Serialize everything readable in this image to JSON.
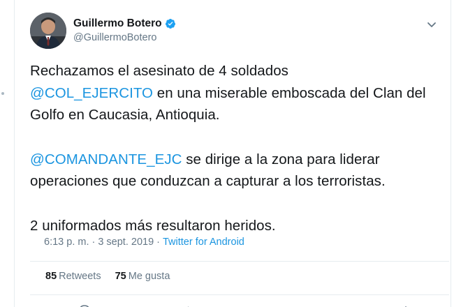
{
  "author": {
    "display_name": "Guillermo Botero",
    "handle": "@GuillermoBotero"
  },
  "tweet": {
    "line1": "Rechazamos el asesinato de 4 soldados",
    "mention1": "@COL_EJERCITO",
    "line2_rest": " en una miserable emboscada del Clan del Golfo en Caucasia, Antioquia.",
    "mention2": "@COMANDANTE_EJC",
    "line3_rest": " se dirige a la zona para liderar operaciones que conduzcan a capturar a los terroristas.",
    "line4": "2 uniformados más resultaron heridos."
  },
  "meta": {
    "time": "6:13 p. m.",
    "sep1": "·",
    "date": "3 sept. 2019",
    "sep2": "·",
    "source": "Twitter for Android"
  },
  "stats": {
    "retweets_count": "85",
    "retweets_label": "Retweets",
    "likes_count": "75",
    "likes_label": "Me gusta"
  },
  "colors": {
    "link": "#1b95e0",
    "secondary_text": "#657786",
    "verified": "#1da1f2",
    "divider": "#e6ecf0"
  },
  "icons": [
    "verified-badge-icon",
    "chevron-down-icon",
    "reply-icon",
    "retweet-icon",
    "like-icon",
    "share-icon"
  ]
}
